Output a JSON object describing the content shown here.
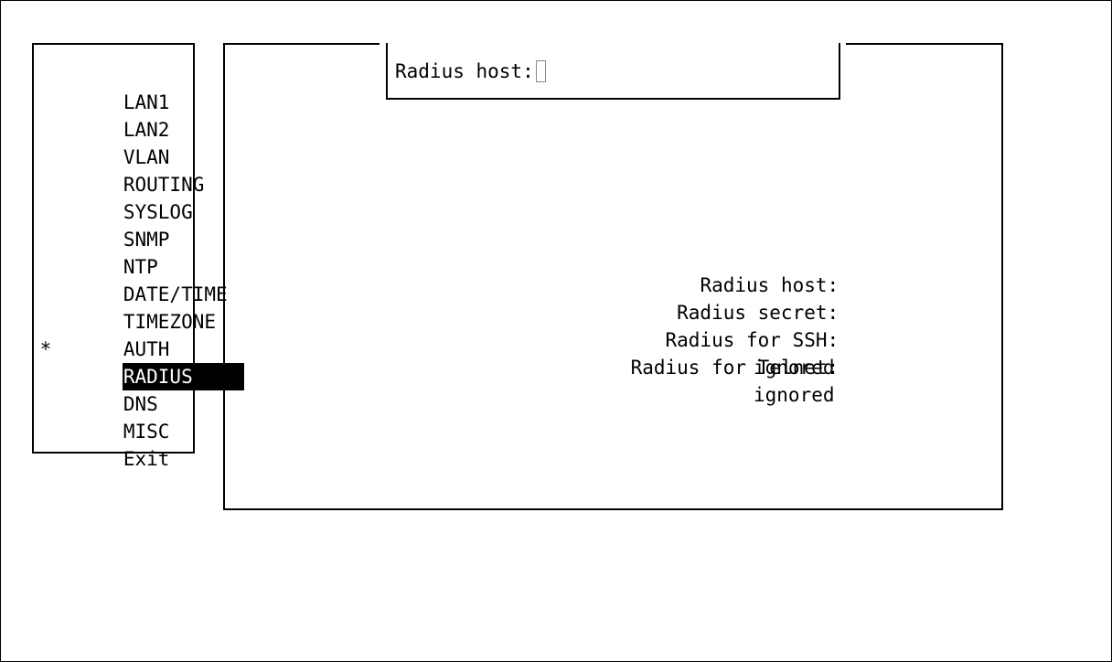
{
  "menu": {
    "items": [
      {
        "label": "LAN1",
        "marker": ""
      },
      {
        "label": "LAN2",
        "marker": ""
      },
      {
        "label": "VLAN",
        "marker": ""
      },
      {
        "label": "ROUTING",
        "marker": ""
      },
      {
        "label": "SYSLOG",
        "marker": ""
      },
      {
        "label": "SNMP",
        "marker": ""
      },
      {
        "label": "NTP",
        "marker": ""
      },
      {
        "label": "DATE/TIME",
        "marker": ""
      },
      {
        "label": "TIMEZONE",
        "marker": ""
      },
      {
        "label": "AUTH",
        "marker": ""
      },
      {
        "label": "RADIUS",
        "marker": "*"
      },
      {
        "label": "DNS",
        "marker": ""
      },
      {
        "label": "MISC",
        "marker": ""
      },
      {
        "label": "Exit",
        "marker": ""
      }
    ],
    "selected": "RADIUS"
  },
  "popup": {
    "prompt": "Radius host:",
    "input_value": ""
  },
  "fields": [
    {
      "label": "Radius host:",
      "value": ""
    },
    {
      "label": "Radius secret:",
      "value": ""
    },
    {
      "label": "Radius for SSH:",
      "value": "ignored"
    },
    {
      "label": "Radius for Telnet:",
      "value": "ignored"
    }
  ]
}
